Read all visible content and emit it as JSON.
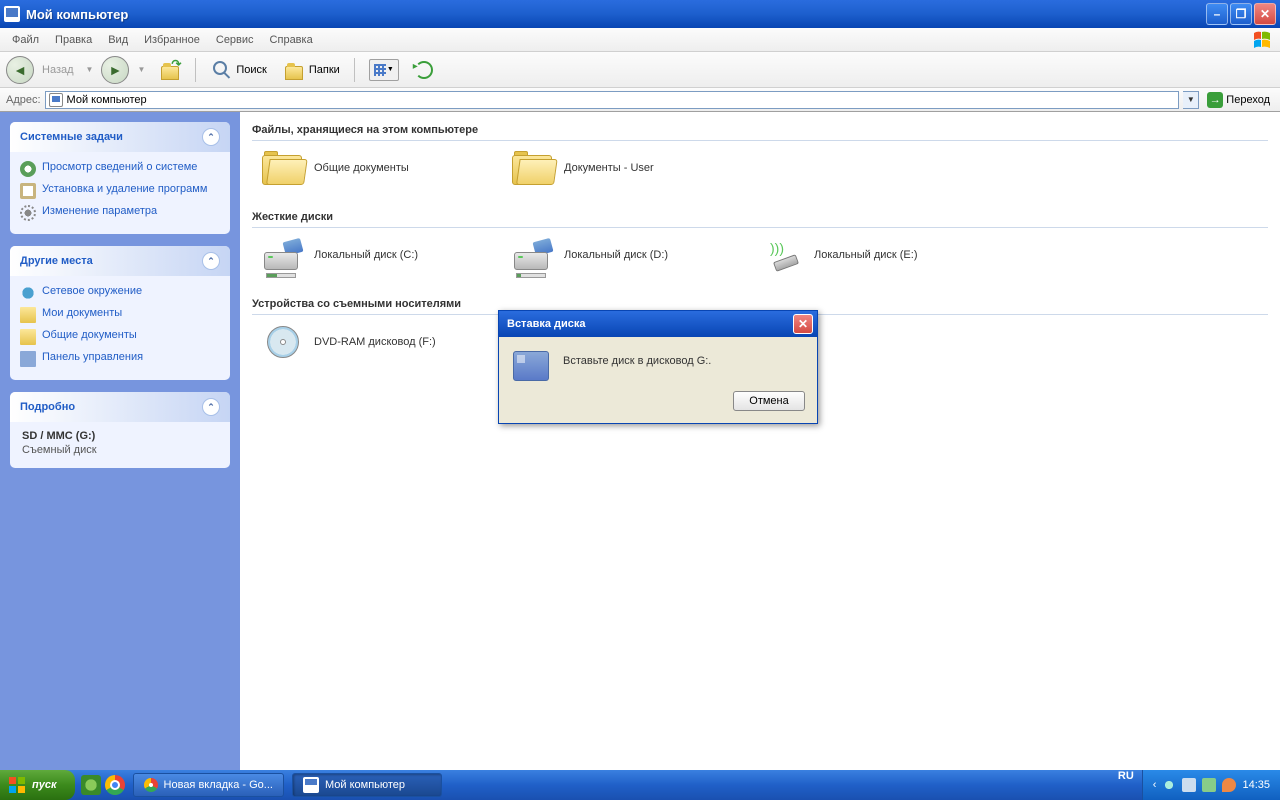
{
  "titlebar": {
    "title": "Мой компьютер"
  },
  "menu": {
    "file": "Файл",
    "edit": "Правка",
    "view": "Вид",
    "favorites": "Избранное",
    "tools": "Сервис",
    "help": "Справка"
  },
  "toolbar": {
    "back": "Назад",
    "search": "Поиск",
    "folders": "Папки"
  },
  "address": {
    "label": "Адрес:",
    "value": "Мой компьютер",
    "go": "Переход"
  },
  "sidebar": {
    "tasks": {
      "title": "Системные задачи",
      "items": [
        "Просмотр сведений о системе",
        "Установка и удаление программ",
        "Изменение параметра"
      ]
    },
    "places": {
      "title": "Другие места",
      "items": [
        "Сетевое окружение",
        "Мои документы",
        "Общие документы",
        "Панель управления"
      ]
    },
    "details": {
      "title": "Подробно",
      "name": "SD / MMC (G:)",
      "type": "Съемный диск"
    }
  },
  "content": {
    "section1": {
      "title": "Файлы, хранящиеся на этом компьютере",
      "items": [
        "Общие документы",
        "Документы - User"
      ]
    },
    "section2": {
      "title": "Жесткие диски",
      "items": [
        "Локальный диск (C:)",
        "Локальный диск (D:)",
        "Локальный диск (E:)"
      ]
    },
    "section3": {
      "title": "Устройства со съемными носителями",
      "items": [
        "DVD-RAM дисковод (F:)"
      ]
    }
  },
  "dialog": {
    "title": "Вставка диска",
    "message": "Вставьте диск в дисковод G:.",
    "cancel": "Отмена"
  },
  "taskbar": {
    "start": "пуск",
    "items": [
      "Новая вкладка - Go...",
      "Мой компьютер"
    ],
    "lang": "RU",
    "clock": "14:35"
  }
}
